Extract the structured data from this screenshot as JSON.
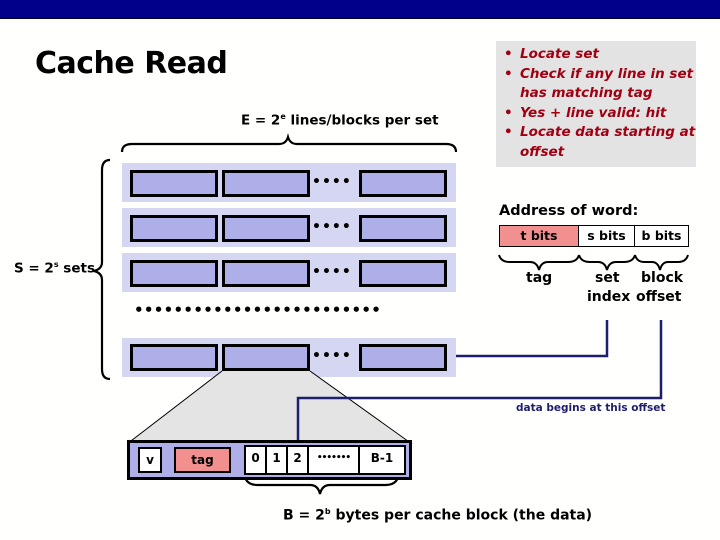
{
  "slide": {
    "title": "Cache Read",
    "colors": {
      "header_bar": "#00008b",
      "set_background": "#d5d6f2",
      "line_fill": "#aeafe8",
      "tag_fill": "#f29090",
      "note_text": "#a00012",
      "note_background": "#e3e3e3",
      "connector": "#1e1e6e"
    }
  },
  "notes": [
    "Locate set",
    "Check if any line in set has matching tag",
    "Yes + line valid: hit",
    "Locate data starting at offset"
  ],
  "cache": {
    "lines_label": {
      "prefix": "E = 2",
      "sup": "e",
      "suffix": " lines/blocks per set"
    },
    "sets_label": {
      "prefix": "S = 2",
      "sup": "s",
      "suffix": " sets"
    },
    "line_dots": "••••",
    "set_dots": "•••••••••••••••••••••••••"
  },
  "address": {
    "heading": "Address of word:",
    "fields": [
      {
        "label": "t bits",
        "name": "tag"
      },
      {
        "label": "s bits",
        "name": "set index"
      },
      {
        "label": "b bits",
        "name": "block offset"
      }
    ],
    "names": {
      "tag": "tag",
      "set_line1": "set",
      "set_line2": "index",
      "block_line1": "block",
      "block_line2": "offset"
    }
  },
  "data_offset_label": "data begins at this offset",
  "block": {
    "valid": "v",
    "tag": "tag",
    "bytes": [
      "0",
      "1",
      "2"
    ],
    "ellipsis": "•••••••",
    "last": "B-1",
    "size_label": {
      "prefix": "B = 2",
      "sup": "b",
      "suffix": " bytes per cache block (the data)"
    }
  }
}
